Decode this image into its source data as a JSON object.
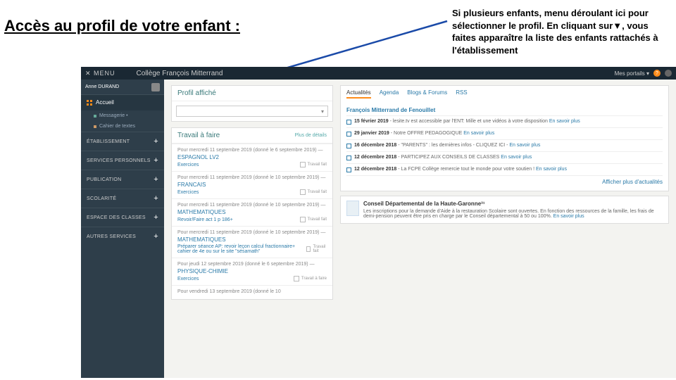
{
  "title": "Accès au profil de votre enfant :",
  "note": "Si plusieurs enfants, menu déroulant ici pour sélectionner le profil. En cliquant sur▼, vous faites apparaître la liste des enfants rattachés à l'établissement",
  "topbar": {
    "menu": "✕ MENU",
    "school": "Collège François Mitterrand",
    "portals": "Mes portails ▾"
  },
  "user": {
    "name": "Anne DURAND"
  },
  "nav": {
    "accueil": "Accueil",
    "msg": "Messagerie •",
    "cdt": "Cahier de textes",
    "sections": [
      "ÉTABLISSEMENT",
      "SERVICES PERSONNELS",
      "PUBLICATION",
      "SCOLARITÉ",
      "ESPACE DES CLASSES",
      "AUTRES SERVICES"
    ]
  },
  "profile": {
    "label": "Profil affiché",
    "dd": "▾"
  },
  "homework": {
    "title": "Travail à faire",
    "more": "Plus de détails",
    "done": "Travail fait",
    "todo": "Travail à faire",
    "items": [
      {
        "date": "Pour mercredi 11 septembre 2019 (donné le 6 septembre 2019) —",
        "subj": "ESPAGNOL LV2",
        "task": "Exercices"
      },
      {
        "date": "Pour mercredi 11 septembre 2019 (donné le 10 septembre 2019) —",
        "subj": "FRANCAIS",
        "task": "Exercices"
      },
      {
        "date": "Pour mercredi 11 septembre 2019 (donné le 10 septembre 2019) —",
        "subj": "MATHEMATIQUES",
        "task": "Revoir/Faire act 1 p 186+"
      },
      {
        "date": "Pour mercredi 11 septembre 2019 (donné le 10 septembre 2019) —",
        "subj": "MATHEMATIQUES",
        "task": "Préparer séance AP: revoir leçon calcul fractionnaire+ cahier de 4e ou sur le site \"sésamath\""
      },
      {
        "date": "Pour jeudi 12 septembre 2019 (donné le 6 septembre 2019) —",
        "subj": "PHYSIQUE-CHIMIE",
        "task": "Exercices"
      },
      {
        "date": "Pour vendredi 13 septembre 2019 (donné le 10",
        "subj": "",
        "task": ""
      }
    ]
  },
  "tabs": [
    "Actualités",
    "Agenda",
    "Blogs & Forums",
    "RSS"
  ],
  "news": {
    "header": "François Mitterrand de Fenouillet",
    "items": [
      {
        "d": "15 février 2019",
        "t": " - lesite.tv est accessible par l'ENT: Mille et une vidéos à votre disposition ",
        "l": "En savoir plus"
      },
      {
        "d": "29 janvier 2019",
        "t": " - Notre OFFRE PEDAGOGIQUE ",
        "l": "En savoir plus"
      },
      {
        "d": "16 décembre 2018",
        "t": " - \"PARENTS\" : les dernières infos - CLIQUEZ ICI - ",
        "l": "En savoir plus"
      },
      {
        "d": "12 décembre 2018",
        "t": " - PARTICIPEZ AUX CONSEILS DE CLASSES ",
        "l": "En savoir plus"
      },
      {
        "d": "12 décembre 2018",
        "t": " - La FCPE Collège remercie tout le monde pour votre soutien ! ",
        "l": "En savoir plus"
      }
    ],
    "more": "Afficher plus d'actualités"
  },
  "info": {
    "title": "Conseil Départemental de la Haute-Garonne³¹",
    "body": "Les inscriptions pour la demande d'Aide à la restauration Scolaire sont ouvertes. En fonction des ressources de la famille, les frais de demi-pension peuvent être pris en charge par le Conseil départemental à 50 ou 100%. ",
    "link": "En savoir plus"
  }
}
